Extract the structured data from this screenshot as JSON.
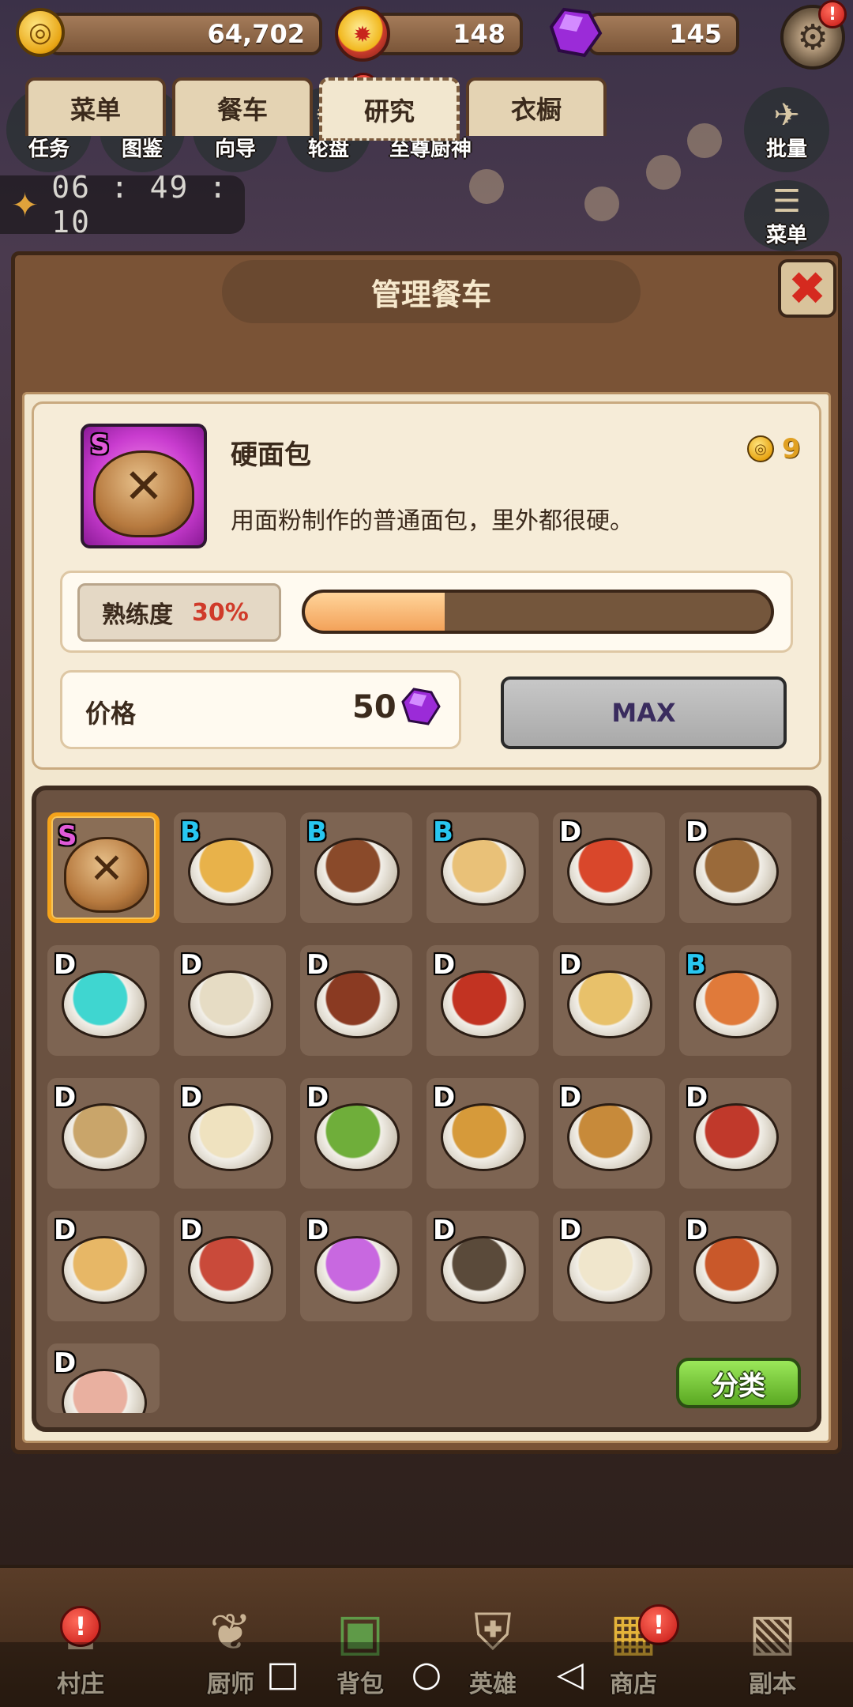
{
  "currencies": {
    "coins": "64,702",
    "medals": "148",
    "gems": "145"
  },
  "shortcuts": [
    {
      "label": "任务",
      "icon": "quest-icon"
    },
    {
      "label": "图鉴",
      "icon": "book-icon"
    },
    {
      "label": "向导",
      "icon": "signpost-icon"
    },
    {
      "label": "轮盘",
      "icon": "roulette-icon"
    },
    {
      "label": "至尊厨神",
      "icon": "chef-icon"
    },
    {
      "label": "批量",
      "icon": "bird-icon"
    },
    {
      "label": "菜单",
      "icon": "menu-board-icon"
    }
  ],
  "timer": "06 : 49 : 10",
  "panel": {
    "title": "管理餐车",
    "tabs": [
      "菜单",
      "餐车",
      "研究",
      "衣橱"
    ],
    "active_tab": "研究"
  },
  "recipe": {
    "grade": "S",
    "name": "硬面包",
    "description": "用面粉制作的普通面包，里外都很硬。",
    "cost": "9",
    "mastery_label": "熟练度",
    "mastery_percent_text": "30%",
    "mastery_fraction": 0.3,
    "price_label": "价格",
    "price": "50",
    "max_label": "MAX"
  },
  "dishes": [
    {
      "grade": "S",
      "name": "hard-bread",
      "color": "#b77a3f"
    },
    {
      "grade": "B",
      "name": "corn-soup",
      "color": "#e8b24a"
    },
    {
      "grade": "B",
      "name": "skewers",
      "color": "#8a4a2a"
    },
    {
      "grade": "B",
      "name": "pizza",
      "color": "#e9c178"
    },
    {
      "grade": "D",
      "name": "sushi",
      "color": "#d9472b"
    },
    {
      "grade": "D",
      "name": "stew-bowl",
      "color": "#9a6a3a"
    },
    {
      "grade": "D",
      "name": "blue-drink",
      "color": "#3fd6d0"
    },
    {
      "grade": "D",
      "name": "clam-pasta",
      "color": "#e6dcc4"
    },
    {
      "grade": "D",
      "name": "meatballs",
      "color": "#8a3a22"
    },
    {
      "grade": "D",
      "name": "tomato-soup",
      "color": "#c23322"
    },
    {
      "grade": "D",
      "name": "tea-cup",
      "color": "#e8c16a"
    },
    {
      "grade": "B",
      "name": "apple-tart",
      "color": "#e07a3a"
    },
    {
      "grade": "D",
      "name": "noodle-soup",
      "color": "#c9a56a"
    },
    {
      "grade": "D",
      "name": "cream-bowl",
      "color": "#efe2bf"
    },
    {
      "grade": "D",
      "name": "salad",
      "color": "#6fae3a"
    },
    {
      "grade": "D",
      "name": "fried-chicken",
      "color": "#d69a3a"
    },
    {
      "grade": "D",
      "name": "bibimbap",
      "color": "#c78a3a"
    },
    {
      "grade": "D",
      "name": "lobster-plate",
      "color": "#c0392b"
    },
    {
      "grade": "D",
      "name": "dumplings",
      "color": "#e7b766"
    },
    {
      "grade": "D",
      "name": "mocha-cup",
      "color": "#c94a3a"
    },
    {
      "grade": "D",
      "name": "cocktail",
      "color": "#c868e0"
    },
    {
      "grade": "D",
      "name": "eel-plate",
      "color": "#5a4a3a"
    },
    {
      "grade": "D",
      "name": "rice-bowl",
      "color": "#f0e6cc"
    },
    {
      "grade": "D",
      "name": "curry-bowl",
      "color": "#c9582a"
    },
    {
      "grade": "D",
      "name": "steamed-buns",
      "color": "#e9b0a0"
    }
  ],
  "sort_label": "分类",
  "bottom_nav": [
    {
      "label": "村庄",
      "icon": "village-icon"
    },
    {
      "label": "厨师",
      "icon": "chicken-icon"
    },
    {
      "label": "背包",
      "icon": "backpack-icon"
    },
    {
      "label": "英雄",
      "icon": "helmet-icon"
    },
    {
      "label": "商店",
      "icon": "treasure-chest-icon"
    },
    {
      "label": "副本",
      "icon": "map-icon"
    }
  ],
  "colors": {
    "panel_brown": "#7a5336",
    "tab_bg": "#e4d3b3",
    "progress_fill": "#f3a25a",
    "grade_S": "#e05ad8",
    "grade_B": "#28c6f0",
    "sort_green": "#5aa822"
  }
}
